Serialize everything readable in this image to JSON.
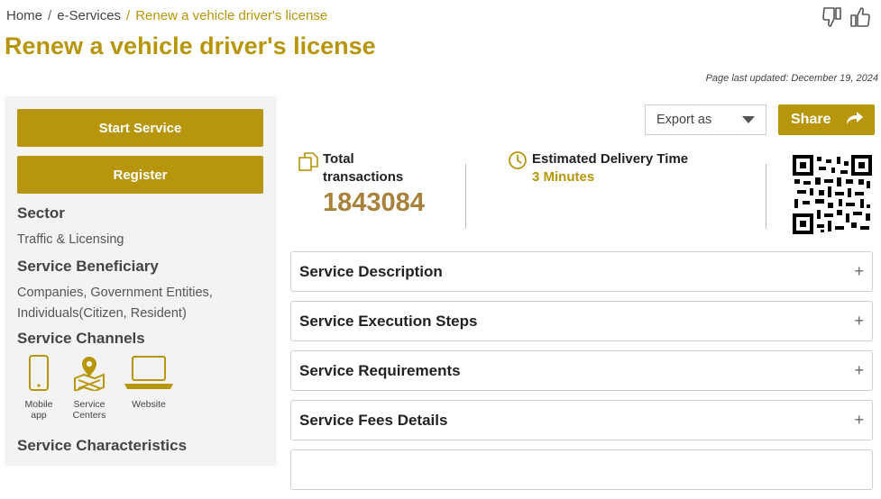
{
  "breadcrumb": {
    "items": [
      "Home",
      "e-Services",
      "Renew a vehicle driver's license"
    ],
    "separator": "/"
  },
  "page": {
    "title": "Renew a vehicle driver's license",
    "last_updated": "Page last updated: December 19, 2024"
  },
  "sidebar": {
    "start_service": "Start Service",
    "register": "Register",
    "sector_heading": "Sector",
    "sector_value": "Traffic & Licensing",
    "beneficiary_heading": "Service Beneficiary",
    "beneficiary_value": "Companies, Government Entities, Individuals(Citizen, Resident)",
    "channels_heading": "Service Channels",
    "channels": [
      {
        "label": "Mobile app",
        "icon": "mobile-icon"
      },
      {
        "label": "Service Centers",
        "icon": "map-pin-icon"
      },
      {
        "label": "Website",
        "icon": "laptop-icon"
      }
    ],
    "characteristics_heading": "Service Characteristics"
  },
  "toolbar": {
    "export_label": "Export as",
    "share_label": "Share"
  },
  "stats": {
    "transactions_label": "Total transactions",
    "transactions_value": "1843084",
    "delivery_label": "Estimated Delivery Time",
    "delivery_value": "3 Minutes"
  },
  "accordion": [
    {
      "title": "Service Description"
    },
    {
      "title": "Service Execution Steps"
    },
    {
      "title": "Service Requirements"
    },
    {
      "title": "Service Fees Details"
    }
  ],
  "colors": {
    "accent": "#b8960c",
    "number": "#a8823c"
  }
}
